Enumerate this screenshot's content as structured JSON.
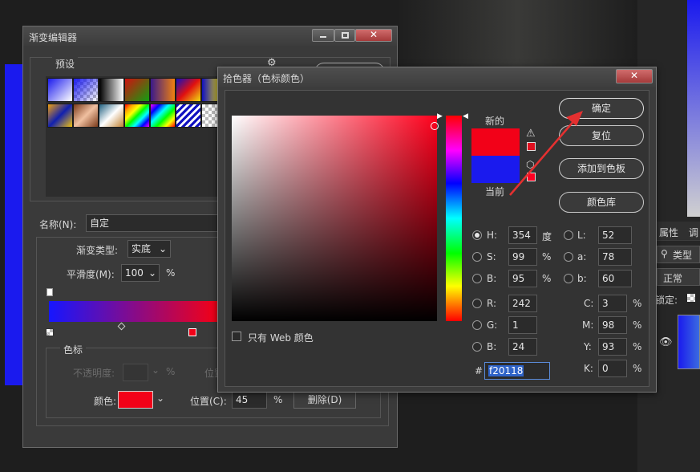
{
  "gradient_editor": {
    "title": "渐变编辑器",
    "presets_label": "预设",
    "name_label": "名称(N):",
    "name_value": "自定",
    "gradient_type_label": "渐变类型:",
    "gradient_type_value": "实底",
    "smoothness_label": "平滑度(M):",
    "smoothness_value": "100",
    "smoothness_unit": "%",
    "stops_group_label": "色标",
    "opacity_label": "不透明度:",
    "opacity_unit": "%",
    "position_label_dim": "位置",
    "color_label": "颜色:",
    "color_value": "#f20118",
    "position_label": "位置(C):",
    "position_value": "45",
    "position_unit": "%",
    "delete_button": "删除(D)",
    "left_color": "#1616ff",
    "right_color": "#f20118"
  },
  "color_picker": {
    "title": "拾色器（色标颜色）",
    "new_label": "新的",
    "current_label": "当前",
    "new_color": "#f20118",
    "current_color": "#1a1aee",
    "ok_button": "确定",
    "reset_button": "复位",
    "add_swatch_button": "添加到色板",
    "color_library_button": "颜色库",
    "web_only_label": "只有 Web 颜色",
    "hue_fill_color": "#ff001c",
    "hsb": {
      "h_label": "H:",
      "h_value": "354",
      "h_unit": "度",
      "s_label": "S:",
      "s_value": "99",
      "s_unit": "%",
      "b_label": "B:",
      "b_value": "95",
      "b_unit": "%"
    },
    "rgb": {
      "r_label": "R:",
      "r_value": "242",
      "g_label": "G:",
      "g_value": "1",
      "b_label": "B:",
      "b_value": "24"
    },
    "lab": {
      "l_label": "L:",
      "l_value": "52",
      "a_label": "a:",
      "a_value": "78",
      "b_label": "b:",
      "b_value": "60"
    },
    "cmyk": {
      "c_label": "C:",
      "c_value": "3",
      "c_unit": "%",
      "m_label": "M:",
      "m_value": "98",
      "m_unit": "%",
      "y_label": "Y:",
      "y_value": "93",
      "y_unit": "%",
      "k_label": "K:",
      "k_value": "0",
      "k_unit": "%"
    },
    "hex_label": "#",
    "hex_value": "f20118",
    "annotation_arrow_color": "#e53030"
  },
  "right_panel": {
    "tab_properties": "属性",
    "tab_adjust": "调",
    "search_label": "类型",
    "blend_mode": "正常",
    "lock_label": "锁定:"
  }
}
